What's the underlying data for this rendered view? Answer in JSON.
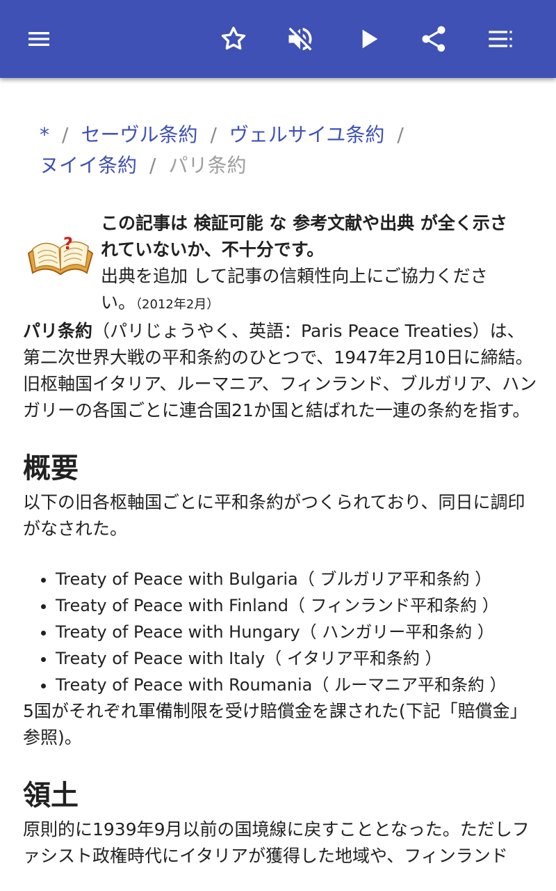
{
  "toolbar": {
    "icons": [
      "menu-icon",
      "star-icon",
      "volume-off-icon",
      "play-icon",
      "share-icon",
      "list-icon"
    ]
  },
  "breadcrumb": {
    "items": [
      "*",
      "セーヴル条約",
      "ヴェルサイユ条約",
      "ヌイイ条約"
    ],
    "separator": "/",
    "current": "パリ条約"
  },
  "notice": {
    "line1": "この記事は 検証可能 な 参考文献や出典 が全く示さ",
    "line2": "れていないか、不十分です。",
    "line3": "出典を追加 して記事の信頼性向上にご協力くださ",
    "line4": "い。",
    "date": "（2012年2月）"
  },
  "intro": {
    "term": "パリ条約",
    "text": "（パリじょうやく、英語：Paris Peace Treaties）は、第二次世界大戦の平和条約のひとつで、1947年2月10日に締結。旧枢軸国イタリア、ルーマニア、フィンランド、ブルガリア、ハンガリーの各国ごとに連合国21か国と結ばれた一連の条約を指す。"
  },
  "section1": {
    "heading": "概要",
    "text": "以下の旧各枢軸国ごとに平和条約がつくられており、同日に調印がなされた。",
    "treaties": [
      "Treaty of Peace with Bulgaria（ ブルガリア平和条約 ）",
      "Treaty of Peace with Finland（ フィンランド平和条約 ）",
      "Treaty of Peace with Hungary（ ハンガリー平和条約 ）",
      "Treaty of Peace with Italy（ イタリア平和条約 ）",
      "Treaty of Peace with Roumania（ ルーマニア平和条約 ）"
    ],
    "after": "5国がそれぞれ軍備制限を受け賠償金を課された(下記「賠償金」参照)。"
  },
  "section2": {
    "heading": "領土",
    "text": "原則的に1939年9月以前の国境線に戻すこととなった。ただしファシスト政権時代にイタリアが獲得した地域や、フィンランド"
  },
  "colors": {
    "appbar": "#3f51b5",
    "link": "#3f51b5",
    "text": "#212121"
  }
}
